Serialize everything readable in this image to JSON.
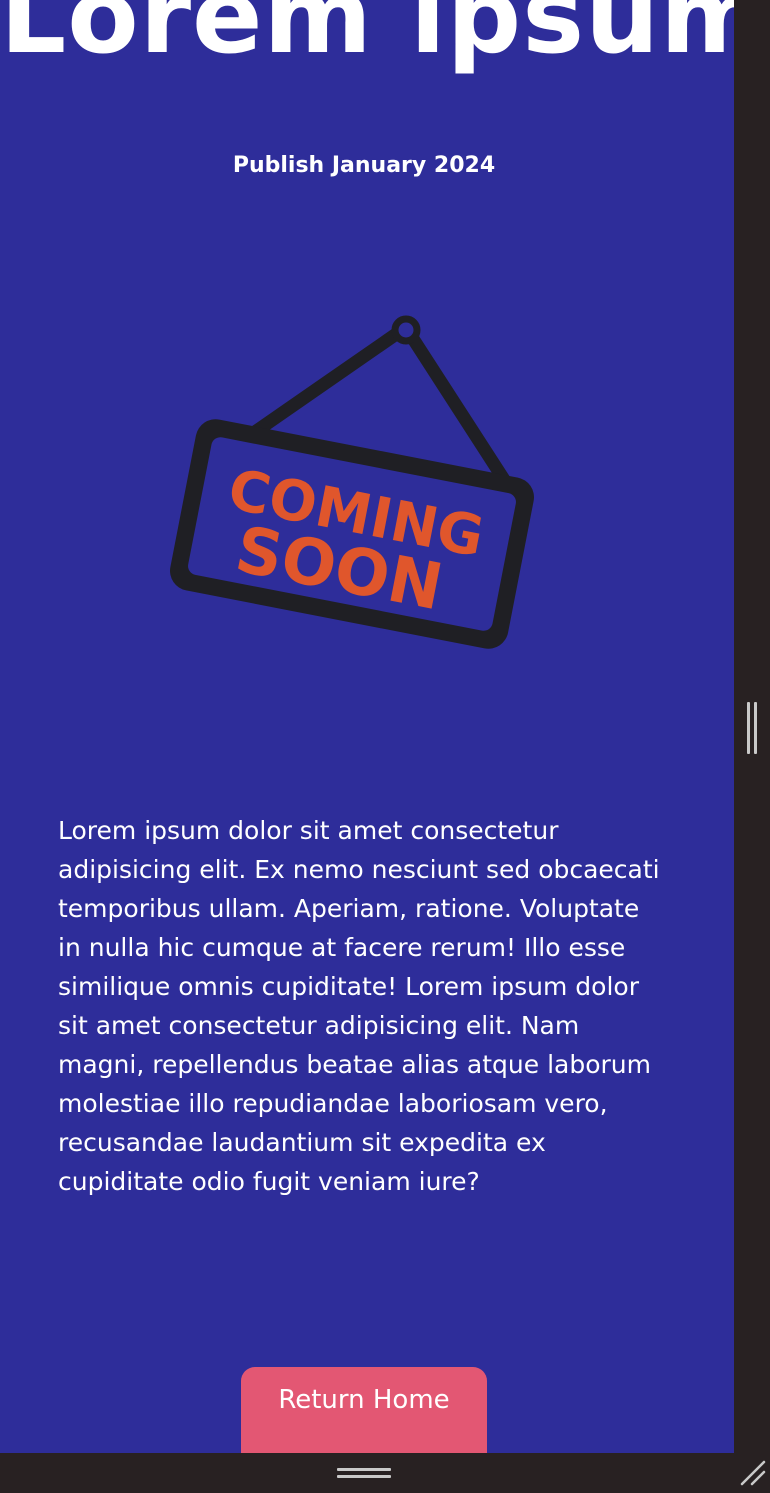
{
  "page": {
    "title": "Lorem ipsum",
    "publish_date": "Publish January 2024"
  },
  "sign": {
    "line1": "COMING",
    "line2": "SOON"
  },
  "content": {
    "paragraph": "Lorem ipsum dolor sit amet consectetur adipisicing elit. Ex nemo nesciunt sed obcaecati temporibus ullam. Aperiam, ratione. Voluptate in nulla hic cumque at facere rerum! Illo esse similique omnis cupiditate! Lorem ipsum dolor sit amet consectetur adipisicing elit. Nam magni, repellendus beatae alias atque laborum molestiae illo repudiandae laboriosam vero, recusandae laudantium sit expedita ex cupiditate odio fugit veniam iure?"
  },
  "actions": {
    "return_home_label": "Return Home"
  },
  "colors": {
    "background": "#2e2d9a",
    "text": "#ffffff",
    "button": "#e35773",
    "sign_frame": "#1f1f24",
    "sign_text": "#e0562c",
    "window_chrome": "#282122"
  },
  "icons": {
    "vertical_scroll": "vertical-scroll-grip-icon",
    "horizontal_scroll": "horizontal-scroll-grip-icon",
    "resize": "resize-grip-icon"
  }
}
